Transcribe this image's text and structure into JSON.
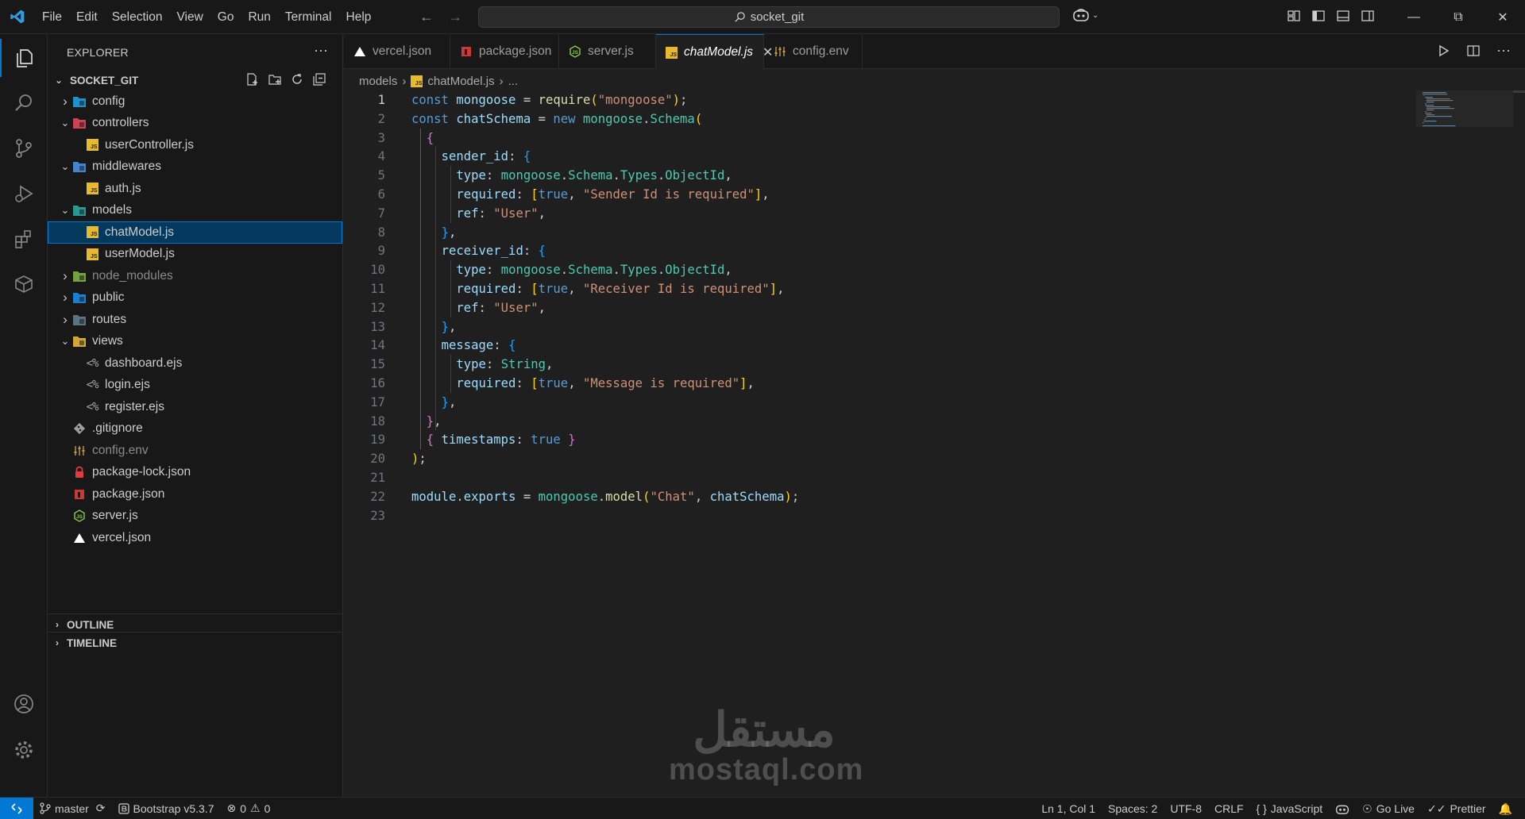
{
  "menu": [
    "File",
    "Edit",
    "Selection",
    "View",
    "Go",
    "Run",
    "Terminal",
    "Help"
  ],
  "search": {
    "text": "socket_git"
  },
  "explorer": {
    "title": "EXPLORER",
    "root": "SOCKET_GIT",
    "tree": [
      {
        "label": "config",
        "type": "folder",
        "open": false,
        "depth": 0,
        "icon": "folder-config-icon",
        "color": "#20a0e0"
      },
      {
        "label": "controllers",
        "type": "folder",
        "open": true,
        "depth": 0,
        "icon": "folder-controllers-icon",
        "color": "#e0465c"
      },
      {
        "label": "userController.js",
        "type": "js",
        "depth": 1
      },
      {
        "label": "middlewares",
        "type": "folder",
        "open": true,
        "depth": 0,
        "icon": "folder-middlewares-icon",
        "color": "#4a90e2"
      },
      {
        "label": "auth.js",
        "type": "js",
        "depth": 1
      },
      {
        "label": "models",
        "type": "folder",
        "open": true,
        "depth": 0,
        "icon": "folder-models-icon",
        "color": "#2aa7a0"
      },
      {
        "label": "chatModel.js",
        "type": "js",
        "depth": 1,
        "selected": true
      },
      {
        "label": "userModel.js",
        "type": "js",
        "depth": 1
      },
      {
        "label": "node_modules",
        "type": "folder",
        "open": false,
        "depth": 0,
        "dim": true,
        "icon": "folder-node-icon",
        "color": "#7cb342"
      },
      {
        "label": "public",
        "type": "folder",
        "open": false,
        "depth": 0,
        "icon": "folder-public-icon",
        "color": "#1e88e5"
      },
      {
        "label": "routes",
        "type": "folder",
        "open": false,
        "depth": 0,
        "icon": "folder-routes-icon",
        "color": "#607d8b"
      },
      {
        "label": "views",
        "type": "folder",
        "open": true,
        "depth": 0,
        "icon": "folder-views-icon",
        "color": "#e5b73b"
      },
      {
        "label": "dashboard.ejs",
        "type": "ejs",
        "depth": 1
      },
      {
        "label": "login.ejs",
        "type": "ejs",
        "depth": 1
      },
      {
        "label": "register.ejs",
        "type": "ejs",
        "depth": 1
      },
      {
        "label": ".gitignore",
        "type": "git",
        "depth": 0
      },
      {
        "label": "config.env",
        "type": "env",
        "depth": 0,
        "dim": true
      },
      {
        "label": "package-lock.json",
        "type": "lock",
        "depth": 0
      },
      {
        "label": "package.json",
        "type": "npm",
        "depth": 0
      },
      {
        "label": "server.js",
        "type": "node",
        "depth": 0
      },
      {
        "label": "vercel.json",
        "type": "vercel",
        "depth": 0
      }
    ],
    "outline": "OUTLINE",
    "timeline": "TIMELINE"
  },
  "tabs": [
    {
      "label": "vercel.json",
      "type": "vercel"
    },
    {
      "label": "package.json",
      "type": "npm"
    },
    {
      "label": "server.js",
      "type": "node"
    },
    {
      "label": "chatModel.js",
      "type": "js",
      "active": true
    },
    {
      "label": "config.env",
      "type": "env"
    }
  ],
  "breadcrumb": {
    "folder": "models",
    "file": "chatModel.js",
    "more": "..."
  },
  "code": [
    [
      [
        "k",
        "const "
      ],
      [
        "v",
        "mongoose"
      ],
      [
        "o",
        " = "
      ],
      [
        "f",
        "require"
      ],
      [
        "p1",
        "("
      ],
      [
        "s",
        "\"mongoose\""
      ],
      [
        "p1",
        ")"
      ],
      [
        "o",
        ";"
      ]
    ],
    [
      [
        "k",
        "const "
      ],
      [
        "v",
        "chatSchema"
      ],
      [
        "o",
        " = "
      ],
      [
        "k",
        "new "
      ],
      [
        "t",
        "mongoose"
      ],
      [
        "o",
        "."
      ],
      [
        "t",
        "Schema"
      ],
      [
        "p1",
        "("
      ]
    ],
    [
      [
        "o",
        "  "
      ],
      [
        "p2",
        "{"
      ]
    ],
    [
      [
        "o",
        "    "
      ],
      [
        "v",
        "sender_id"
      ],
      [
        "o",
        ": "
      ],
      [
        "p3",
        "{"
      ]
    ],
    [
      [
        "o",
        "      "
      ],
      [
        "v",
        "type"
      ],
      [
        "o",
        ": "
      ],
      [
        "t",
        "mongoose"
      ],
      [
        "o",
        "."
      ],
      [
        "t",
        "Schema"
      ],
      [
        "o",
        "."
      ],
      [
        "t",
        "Types"
      ],
      [
        "o",
        "."
      ],
      [
        "t",
        "ObjectId"
      ],
      [
        "o",
        ","
      ]
    ],
    [
      [
        "o",
        "      "
      ],
      [
        "v",
        "required"
      ],
      [
        "o",
        ": "
      ],
      [
        "p1",
        "["
      ],
      [
        "k",
        "true"
      ],
      [
        "o",
        ", "
      ],
      [
        "s",
        "\"Sender Id is required\""
      ],
      [
        "p1",
        "]"
      ],
      [
        "o",
        ","
      ]
    ],
    [
      [
        "o",
        "      "
      ],
      [
        "v",
        "ref"
      ],
      [
        "o",
        ": "
      ],
      [
        "s",
        "\"User\""
      ],
      [
        "o",
        ","
      ]
    ],
    [
      [
        "o",
        "    "
      ],
      [
        "p3",
        "}"
      ],
      [
        "o",
        ","
      ]
    ],
    [
      [
        "o",
        "    "
      ],
      [
        "v",
        "receiver_id"
      ],
      [
        "o",
        ": "
      ],
      [
        "p3",
        "{"
      ]
    ],
    [
      [
        "o",
        "      "
      ],
      [
        "v",
        "type"
      ],
      [
        "o",
        ": "
      ],
      [
        "t",
        "mongoose"
      ],
      [
        "o",
        "."
      ],
      [
        "t",
        "Schema"
      ],
      [
        "o",
        "."
      ],
      [
        "t",
        "Types"
      ],
      [
        "o",
        "."
      ],
      [
        "t",
        "ObjectId"
      ],
      [
        "o",
        ","
      ]
    ],
    [
      [
        "o",
        "      "
      ],
      [
        "v",
        "required"
      ],
      [
        "o",
        ": "
      ],
      [
        "p1",
        "["
      ],
      [
        "k",
        "true"
      ],
      [
        "o",
        ", "
      ],
      [
        "s",
        "\"Receiver Id is required\""
      ],
      [
        "p1",
        "]"
      ],
      [
        "o",
        ","
      ]
    ],
    [
      [
        "o",
        "      "
      ],
      [
        "v",
        "ref"
      ],
      [
        "o",
        ": "
      ],
      [
        "s",
        "\"User\""
      ],
      [
        "o",
        ","
      ]
    ],
    [
      [
        "o",
        "    "
      ],
      [
        "p3",
        "}"
      ],
      [
        "o",
        ","
      ]
    ],
    [
      [
        "o",
        "    "
      ],
      [
        "v",
        "message"
      ],
      [
        "o",
        ": "
      ],
      [
        "p3",
        "{"
      ]
    ],
    [
      [
        "o",
        "      "
      ],
      [
        "v",
        "type"
      ],
      [
        "o",
        ": "
      ],
      [
        "t",
        "String"
      ],
      [
        "o",
        ","
      ]
    ],
    [
      [
        "o",
        "      "
      ],
      [
        "v",
        "required"
      ],
      [
        "o",
        ": "
      ],
      [
        "p1",
        "["
      ],
      [
        "k",
        "true"
      ],
      [
        "o",
        ", "
      ],
      [
        "s",
        "\"Message is required\""
      ],
      [
        "p1",
        "]"
      ],
      [
        "o",
        ","
      ]
    ],
    [
      [
        "o",
        "    "
      ],
      [
        "p3",
        "}"
      ],
      [
        "o",
        ","
      ]
    ],
    [
      [
        "o",
        "  "
      ],
      [
        "p2",
        "}"
      ],
      [
        "o",
        ","
      ]
    ],
    [
      [
        "o",
        "  "
      ],
      [
        "p2",
        "{"
      ],
      [
        "o",
        " "
      ],
      [
        "v",
        "timestamps"
      ],
      [
        "o",
        ": "
      ],
      [
        "k",
        "true"
      ],
      [
        "o",
        " "
      ],
      [
        "p2",
        "}"
      ]
    ],
    [
      [
        "p1",
        ")"
      ],
      [
        "o",
        ";"
      ]
    ],
    [],
    [
      [
        "v",
        "module"
      ],
      [
        "o",
        "."
      ],
      [
        "v",
        "exports"
      ],
      [
        "o",
        " = "
      ],
      [
        "t",
        "mongoose"
      ],
      [
        "o",
        "."
      ],
      [
        "f",
        "model"
      ],
      [
        "p1",
        "("
      ],
      [
        "s",
        "\"Chat\""
      ],
      [
        "o",
        ", "
      ],
      [
        "v",
        "chatSchema"
      ],
      [
        "p1",
        ")"
      ],
      [
        "o",
        ";"
      ]
    ],
    []
  ],
  "watermark": {
    "arabic": "مستقل",
    "latin": "mostaql.com"
  },
  "status": {
    "branch": "master",
    "bootstrap": "Bootstrap v5.3.7",
    "errors": "0",
    "warnings": "0",
    "position": "Ln 1, Col 1",
    "spaces": "Spaces: 2",
    "encoding": "UTF-8",
    "eol": "CRLF",
    "language": "JavaScript",
    "golive": "Go Live",
    "prettier": "Prettier"
  },
  "colors": {
    "accent": "#0078d4",
    "background": "#1f1f1f",
    "chrome": "#181818"
  }
}
